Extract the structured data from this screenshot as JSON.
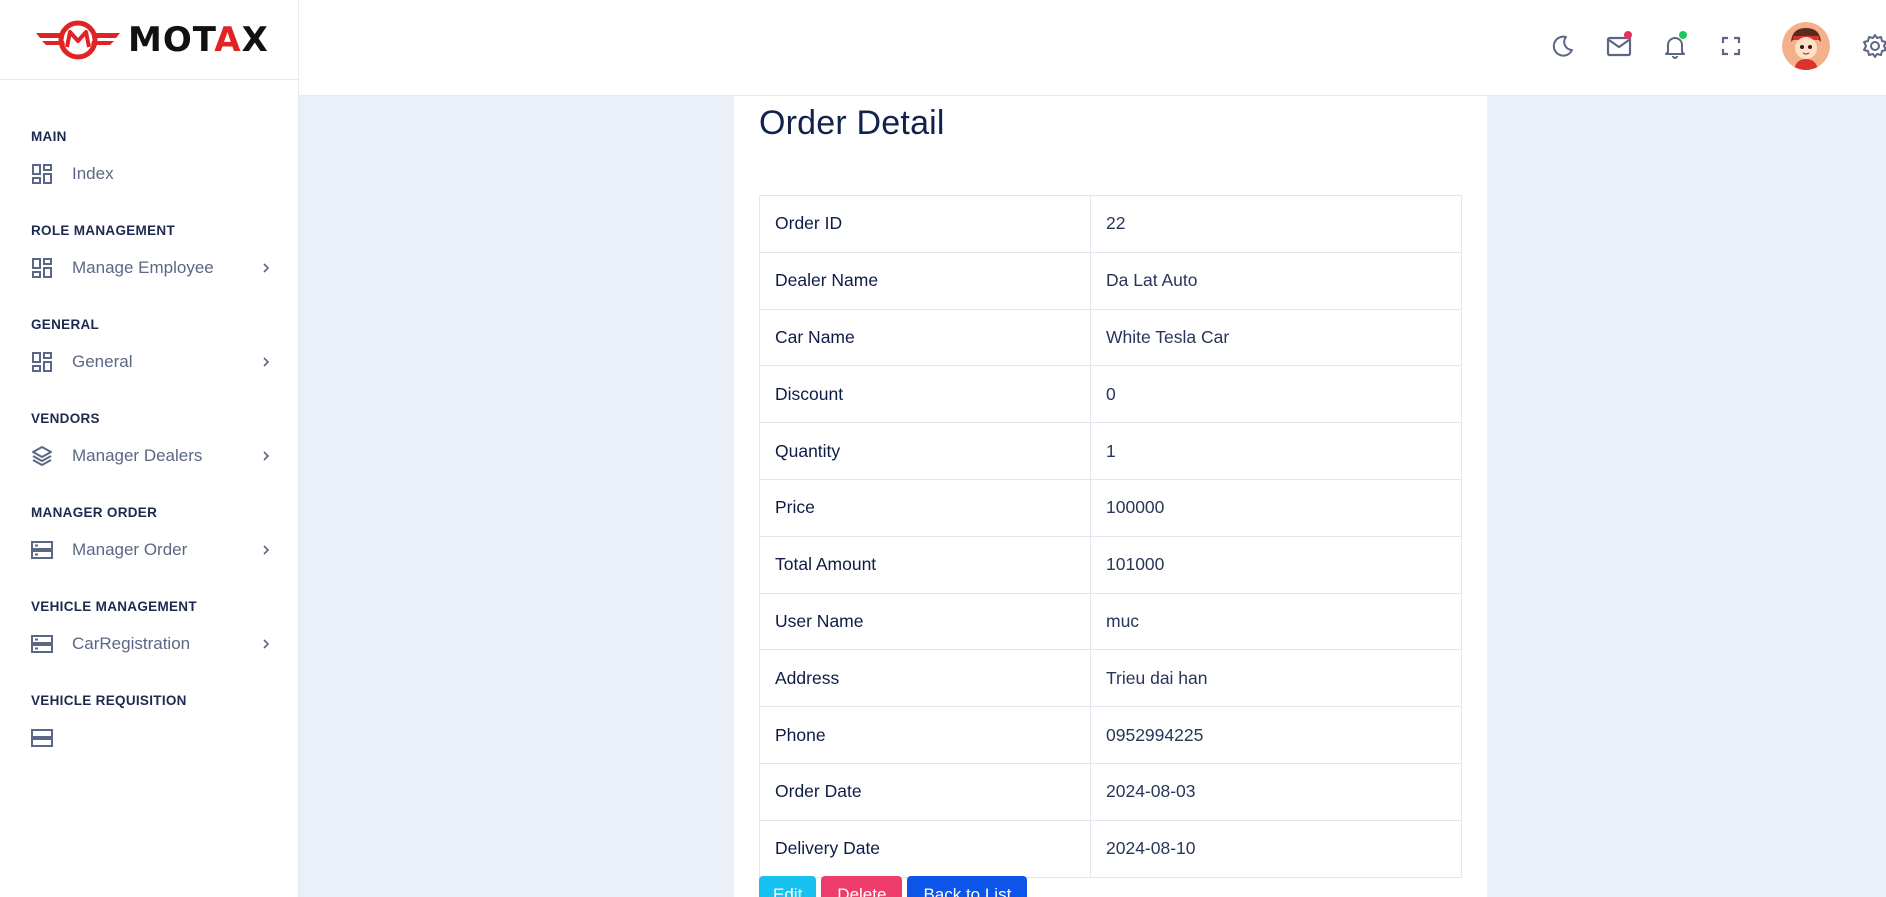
{
  "brand": {
    "name_left": "MOT",
    "name_red": "A",
    "name_right": "X",
    "accent": "#e02424"
  },
  "sidebar": {
    "sections": [
      {
        "heading": "MAIN",
        "item": {
          "label": "Index",
          "icon": "grid-icon",
          "chevron": false
        }
      },
      {
        "heading": "ROLE MANAGEMENT",
        "item": {
          "label": "Manage Employee",
          "icon": "grid-icon",
          "chevron": true
        }
      },
      {
        "heading": "GENERAL",
        "item": {
          "label": "General",
          "icon": "grid-icon",
          "chevron": true
        }
      },
      {
        "heading": "VENDORS",
        "item": {
          "label": "Manager Dealers",
          "icon": "layers-icon",
          "chevron": true
        }
      },
      {
        "heading": "MANAGER ORDER",
        "item": {
          "label": "Manager Order",
          "icon": "server-icon",
          "chevron": true
        }
      },
      {
        "heading": "VEHICLE MANAGEMENT",
        "item": {
          "label": "CarRegistration",
          "icon": "server-icon",
          "chevron": true
        }
      },
      {
        "heading": "VEHICLE REQUISITION",
        "item": {
          "label": "",
          "icon": "server-icon",
          "chevron": true
        }
      }
    ]
  },
  "header": {
    "icons": [
      "moon-icon",
      "mail-icon",
      "bell-icon",
      "fullscreen-icon",
      "avatar",
      "gear-icon"
    ],
    "mail_badge_color": "#e8305f",
    "bell_badge_color": "#22c55e"
  },
  "order": {
    "title": "Order Detail",
    "rows": [
      {
        "label": "Order ID",
        "value": "22"
      },
      {
        "label": "Dealer Name",
        "value": "Da Lat Auto"
      },
      {
        "label": "Car Name",
        "value": "White Tesla Car"
      },
      {
        "label": "Discount",
        "value": "0"
      },
      {
        "label": "Quantity",
        "value": "1"
      },
      {
        "label": "Price",
        "value": "100000"
      },
      {
        "label": "Total Amount",
        "value": "101000"
      },
      {
        "label": "User Name",
        "value": "muc"
      },
      {
        "label": "Address",
        "value": "Trieu dai han"
      },
      {
        "label": "Phone",
        "value": "0952994225"
      },
      {
        "label": "Order Date",
        "value": "2024-08-03"
      },
      {
        "label": "Delivery Date",
        "value": "2024-08-10"
      }
    ],
    "actions": {
      "edit": "Edit",
      "delete": "Delete",
      "back": "Back to List"
    }
  }
}
